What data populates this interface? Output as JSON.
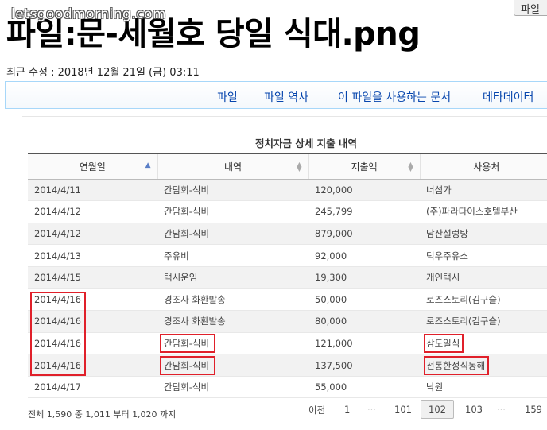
{
  "watermark": "letsgoodmorning.com",
  "top_button": "파일",
  "page": {
    "title": "파일:문-세월호 당일 식대.png",
    "modified": "최근 수정 : 2018년 12월 21일 (금) 03:11"
  },
  "tabs": [
    "파일",
    "파일 역사",
    "이 파일을 사용하는 문서",
    "메타데이터"
  ],
  "table": {
    "title": "정치자금 상세 지출 내역",
    "headers": [
      "연월일",
      "내역",
      "지출액",
      "사용처"
    ],
    "rows": [
      [
        "2014/4/11",
        "간담회-식비",
        "120,000",
        "너섬가"
      ],
      [
        "2014/4/12",
        "간담회-식비",
        "245,799",
        "(주)파라다이스호텔부산"
      ],
      [
        "2014/4/12",
        "간담회-식비",
        "879,000",
        "남산설렁탕"
      ],
      [
        "2014/4/13",
        "주유비",
        "92,000",
        "덕우주유소"
      ],
      [
        "2014/4/15",
        "택시운임",
        "19,300",
        "개인택시"
      ],
      [
        "2014/4/16",
        "경조사 화환발송",
        "50,000",
        "로즈스토리(김구슬)"
      ],
      [
        "2014/4/16",
        "경조사 화환발송",
        "80,000",
        "로즈스토리(김구슬)"
      ],
      [
        "2014/4/16",
        "간담회-식비",
        "121,000",
        "삼도일식"
      ],
      [
        "2014/4/16",
        "간담회-식비",
        "137,500",
        "전통한정식동해"
      ],
      [
        "2014/4/17",
        "간담회-식비",
        "55,000",
        "낙원"
      ]
    ]
  },
  "footer": {
    "info": "전체 1,590 중 1,011 부터 1,020 까지",
    "pager": {
      "prev": "이전",
      "first": "1",
      "ellipsis": "···",
      "p101": "101",
      "current": "102",
      "p103": "103",
      "last": "159"
    }
  },
  "colors": {
    "highlight": "#e0202a",
    "link": "#0645ad",
    "tab_border": "#a7d7f9"
  }
}
